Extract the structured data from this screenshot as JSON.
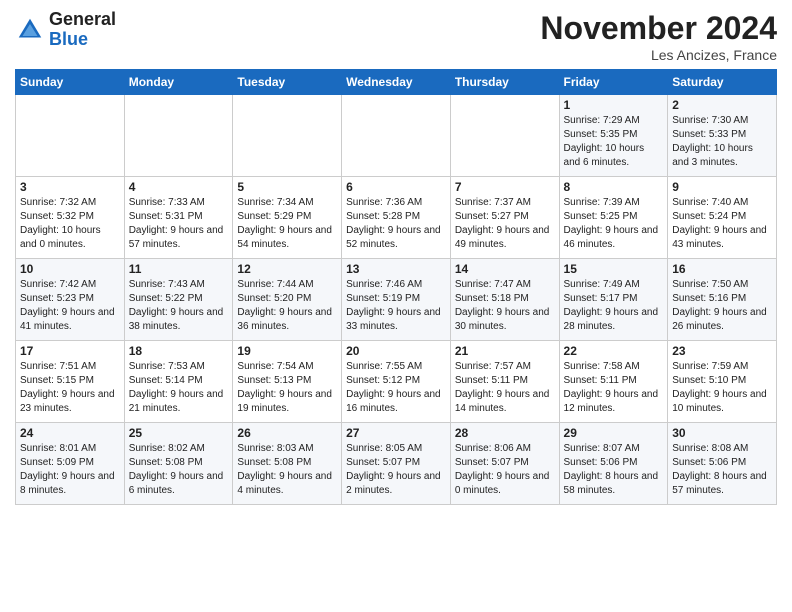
{
  "header": {
    "logo_general": "General",
    "logo_blue": "Blue",
    "month_title": "November 2024",
    "location": "Les Ancizes, France"
  },
  "days_of_week": [
    "Sunday",
    "Monday",
    "Tuesday",
    "Wednesday",
    "Thursday",
    "Friday",
    "Saturday"
  ],
  "weeks": [
    [
      {
        "num": "",
        "info": ""
      },
      {
        "num": "",
        "info": ""
      },
      {
        "num": "",
        "info": ""
      },
      {
        "num": "",
        "info": ""
      },
      {
        "num": "",
        "info": ""
      },
      {
        "num": "1",
        "info": "Sunrise: 7:29 AM\nSunset: 5:35 PM\nDaylight: 10 hours and 6 minutes."
      },
      {
        "num": "2",
        "info": "Sunrise: 7:30 AM\nSunset: 5:33 PM\nDaylight: 10 hours and 3 minutes."
      }
    ],
    [
      {
        "num": "3",
        "info": "Sunrise: 7:32 AM\nSunset: 5:32 PM\nDaylight: 10 hours and 0 minutes."
      },
      {
        "num": "4",
        "info": "Sunrise: 7:33 AM\nSunset: 5:31 PM\nDaylight: 9 hours and 57 minutes."
      },
      {
        "num": "5",
        "info": "Sunrise: 7:34 AM\nSunset: 5:29 PM\nDaylight: 9 hours and 54 minutes."
      },
      {
        "num": "6",
        "info": "Sunrise: 7:36 AM\nSunset: 5:28 PM\nDaylight: 9 hours and 52 minutes."
      },
      {
        "num": "7",
        "info": "Sunrise: 7:37 AM\nSunset: 5:27 PM\nDaylight: 9 hours and 49 minutes."
      },
      {
        "num": "8",
        "info": "Sunrise: 7:39 AM\nSunset: 5:25 PM\nDaylight: 9 hours and 46 minutes."
      },
      {
        "num": "9",
        "info": "Sunrise: 7:40 AM\nSunset: 5:24 PM\nDaylight: 9 hours and 43 minutes."
      }
    ],
    [
      {
        "num": "10",
        "info": "Sunrise: 7:42 AM\nSunset: 5:23 PM\nDaylight: 9 hours and 41 minutes."
      },
      {
        "num": "11",
        "info": "Sunrise: 7:43 AM\nSunset: 5:22 PM\nDaylight: 9 hours and 38 minutes."
      },
      {
        "num": "12",
        "info": "Sunrise: 7:44 AM\nSunset: 5:20 PM\nDaylight: 9 hours and 36 minutes."
      },
      {
        "num": "13",
        "info": "Sunrise: 7:46 AM\nSunset: 5:19 PM\nDaylight: 9 hours and 33 minutes."
      },
      {
        "num": "14",
        "info": "Sunrise: 7:47 AM\nSunset: 5:18 PM\nDaylight: 9 hours and 30 minutes."
      },
      {
        "num": "15",
        "info": "Sunrise: 7:49 AM\nSunset: 5:17 PM\nDaylight: 9 hours and 28 minutes."
      },
      {
        "num": "16",
        "info": "Sunrise: 7:50 AM\nSunset: 5:16 PM\nDaylight: 9 hours and 26 minutes."
      }
    ],
    [
      {
        "num": "17",
        "info": "Sunrise: 7:51 AM\nSunset: 5:15 PM\nDaylight: 9 hours and 23 minutes."
      },
      {
        "num": "18",
        "info": "Sunrise: 7:53 AM\nSunset: 5:14 PM\nDaylight: 9 hours and 21 minutes."
      },
      {
        "num": "19",
        "info": "Sunrise: 7:54 AM\nSunset: 5:13 PM\nDaylight: 9 hours and 19 minutes."
      },
      {
        "num": "20",
        "info": "Sunrise: 7:55 AM\nSunset: 5:12 PM\nDaylight: 9 hours and 16 minutes."
      },
      {
        "num": "21",
        "info": "Sunrise: 7:57 AM\nSunset: 5:11 PM\nDaylight: 9 hours and 14 minutes."
      },
      {
        "num": "22",
        "info": "Sunrise: 7:58 AM\nSunset: 5:11 PM\nDaylight: 9 hours and 12 minutes."
      },
      {
        "num": "23",
        "info": "Sunrise: 7:59 AM\nSunset: 5:10 PM\nDaylight: 9 hours and 10 minutes."
      }
    ],
    [
      {
        "num": "24",
        "info": "Sunrise: 8:01 AM\nSunset: 5:09 PM\nDaylight: 9 hours and 8 minutes."
      },
      {
        "num": "25",
        "info": "Sunrise: 8:02 AM\nSunset: 5:08 PM\nDaylight: 9 hours and 6 minutes."
      },
      {
        "num": "26",
        "info": "Sunrise: 8:03 AM\nSunset: 5:08 PM\nDaylight: 9 hours and 4 minutes."
      },
      {
        "num": "27",
        "info": "Sunrise: 8:05 AM\nSunset: 5:07 PM\nDaylight: 9 hours and 2 minutes."
      },
      {
        "num": "28",
        "info": "Sunrise: 8:06 AM\nSunset: 5:07 PM\nDaylight: 9 hours and 0 minutes."
      },
      {
        "num": "29",
        "info": "Sunrise: 8:07 AM\nSunset: 5:06 PM\nDaylight: 8 hours and 58 minutes."
      },
      {
        "num": "30",
        "info": "Sunrise: 8:08 AM\nSunset: 5:06 PM\nDaylight: 8 hours and 57 minutes."
      }
    ]
  ]
}
